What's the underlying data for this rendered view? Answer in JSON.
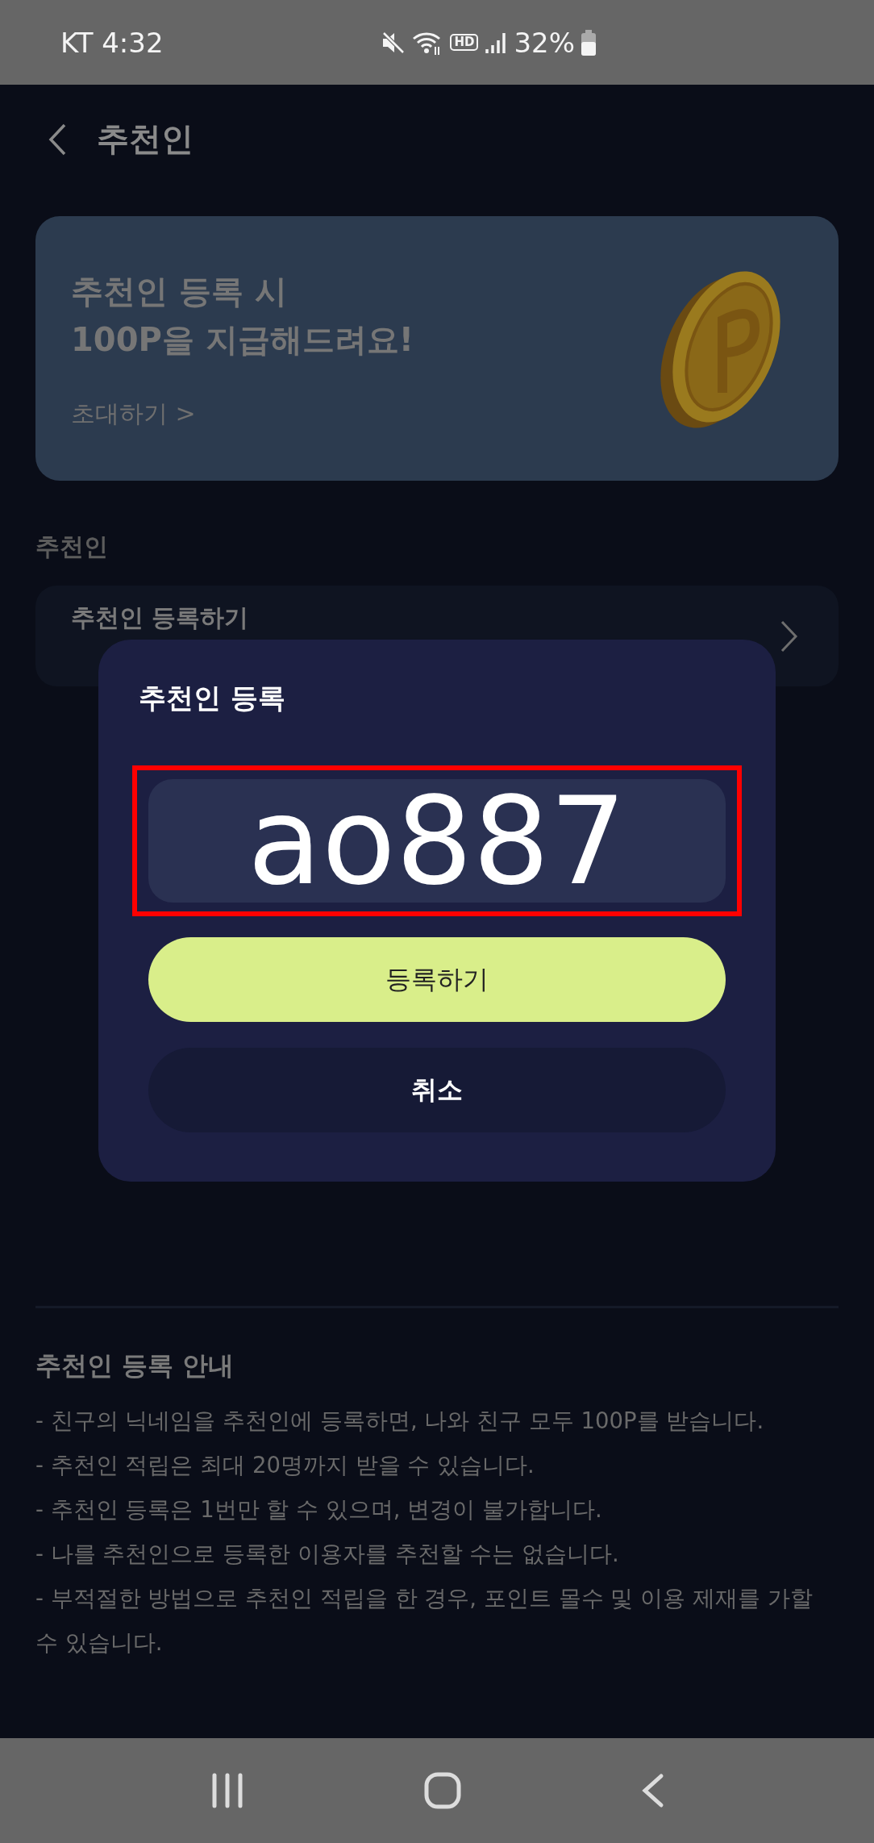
{
  "status_bar": {
    "carrier_time": "KT 4:32",
    "hd": "HD",
    "battery": "32%"
  },
  "header": {
    "title": "추천인"
  },
  "banner": {
    "lines": [
      "추천인 등록 시",
      "100P을 지급해드려요!"
    ],
    "link": "초대하기 >"
  },
  "section": {
    "label": "추천인",
    "row": "추천인 등록하기"
  },
  "guide": {
    "title": "추천인 등록 안내",
    "items": [
      "- 친구의 닉네임을 추천인에 등록하면, 나와 친구 모두 100P를 받습니다.",
      "- 추천인 적립은 최대 20명까지 받을 수 있습니다.",
      "- 추천인 등록은 1번만 할 수 있으며, 변경이 불가합니다.",
      "- 나를 추천인으로 등록한 이용자를 추천할 수는 없습니다.",
      "- 부적절한 방법으로 추천인 적립을 한 경우, 포인트 몰수 및 이용 제재를 가할 수 있습니다."
    ]
  },
  "dialog": {
    "title": "추천인 등록",
    "input": {
      "value": "ao887",
      "highlighted": true
    },
    "buttons": [
      {
        "label": "등록하기",
        "kind": "primary"
      },
      {
        "label": "취소",
        "kind": "secondary"
      }
    ]
  }
}
